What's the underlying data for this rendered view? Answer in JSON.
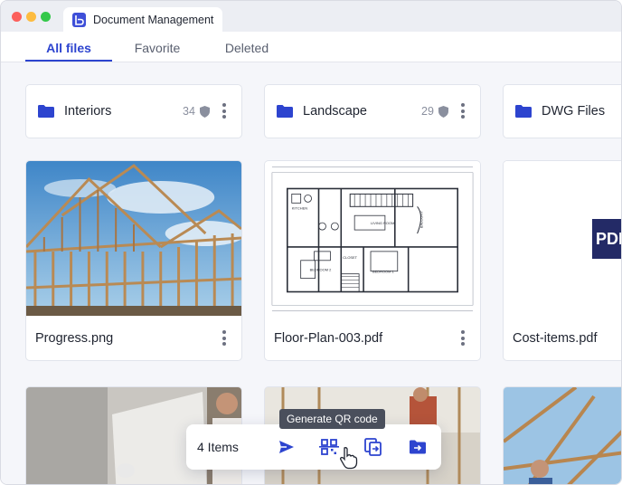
{
  "window": {
    "tab_title": "Document Management"
  },
  "nav": {
    "tabs": [
      {
        "label": "All files",
        "active": true
      },
      {
        "label": "Favorite",
        "active": false
      },
      {
        "label": "Deleted",
        "active": false
      }
    ]
  },
  "folders": [
    {
      "name": "Interiors",
      "count": "34"
    },
    {
      "name": "Landscape",
      "count": "29"
    },
    {
      "name": "DWG Files",
      "count": ""
    }
  ],
  "files": [
    {
      "name": "Progress.png",
      "thumb": "house-framing-photo"
    },
    {
      "name": "Floor-Plan-003.pdf",
      "thumb": "floor-plan-drawing"
    },
    {
      "name": "Cost-items.pdf",
      "thumb": "pdf-icon",
      "badge": "PDF"
    }
  ],
  "floor_plan_labels": {
    "kitchen": "KITCHEN",
    "living_room": "LIVING ROOM",
    "bedroom_2": "BEDROOM 2",
    "bedroom_1": "BEDROOM 1",
    "closet": "CLOSET",
    "balcony": "BALCONY"
  },
  "action_bar": {
    "count_label": "4 Items",
    "tooltip": "Generate QR code",
    "icons": [
      "send-icon",
      "qr-code-icon",
      "copy-to-icon",
      "move-to-folder-icon"
    ]
  },
  "colors": {
    "accent": "#2d44cf",
    "folder": "#2d44cf",
    "pdf_badge": "#232a66"
  }
}
